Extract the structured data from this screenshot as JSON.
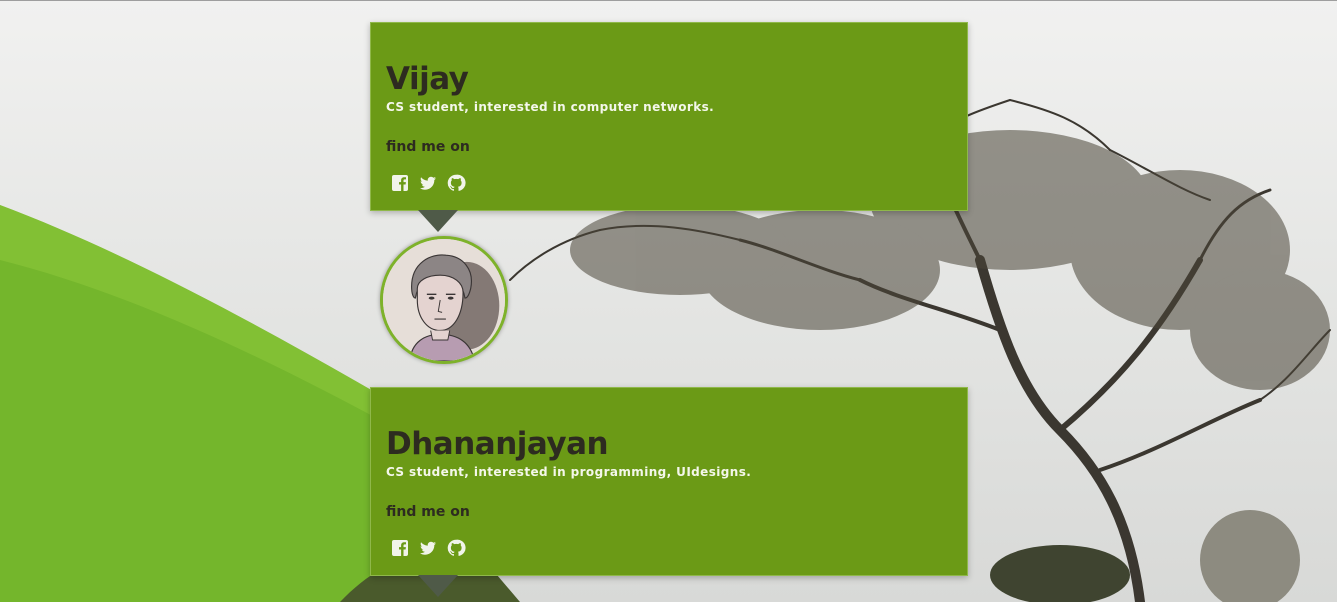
{
  "people": [
    {
      "name": "Vijay",
      "bio": "CS student, interested in computer networks.",
      "find_label": "find me on",
      "social": [
        "facebook-icon",
        "twitter-icon",
        "github-icon"
      ]
    },
    {
      "name": "Dhananjayan",
      "bio": "CS student, interested in programming, UIdesigns.",
      "find_label": "find me on",
      "social": [
        "facebook-icon",
        "twitter-icon",
        "github-icon"
      ]
    }
  ],
  "colors": {
    "card": "#6b9a16",
    "name_text": "#2d2b20",
    "bio_text": "#f4f7ea",
    "pointer": "#4f5a48",
    "avatar_ring": "#7eb22a"
  }
}
